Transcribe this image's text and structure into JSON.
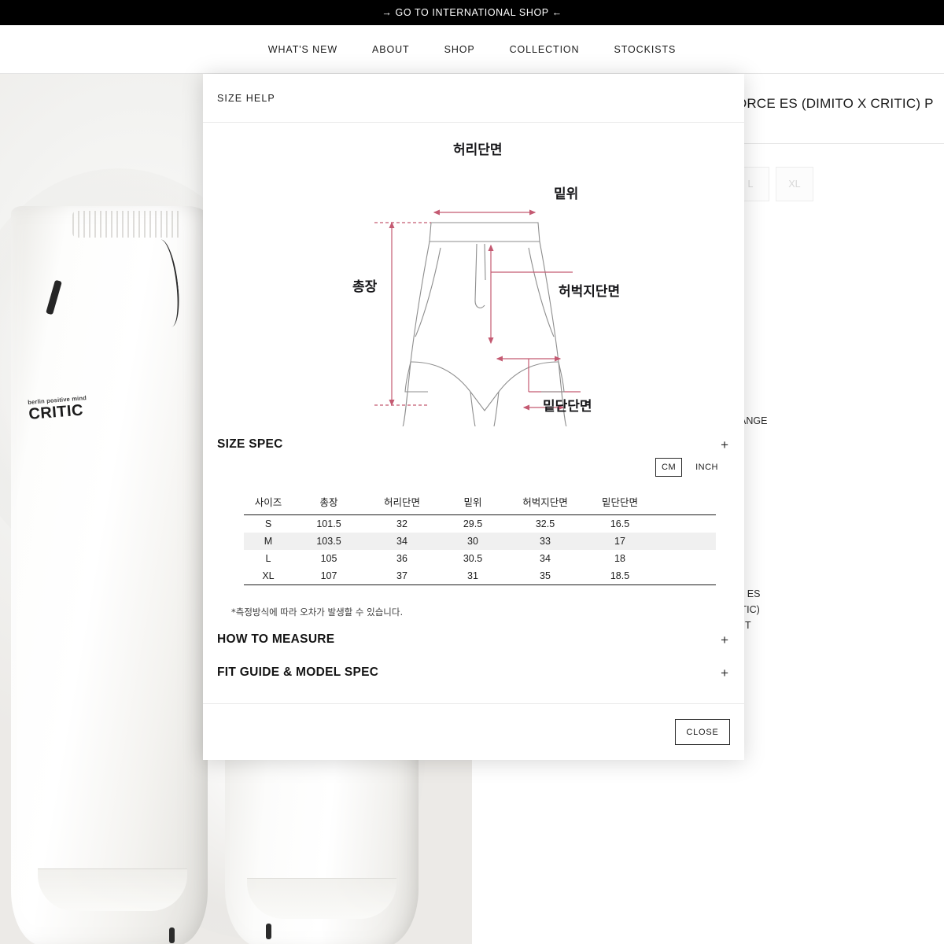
{
  "banner": {
    "text": "→ GO TO INTERNATIONAL SHOP ←"
  },
  "nav": {
    "items": [
      {
        "label": "WHAT'S NEW"
      },
      {
        "label": "ABOUT"
      },
      {
        "label": "SHOP"
      },
      {
        "label": "COLLECTION"
      },
      {
        "label": "STOCKISTS"
      }
    ]
  },
  "product": {
    "title_fragment": "ORCE ES (DIMITO X CRITIC) P",
    "sizes": [
      {
        "label": "L",
        "disabled": true
      },
      {
        "label": "XL",
        "disabled": true
      }
    ],
    "info_fragment_1": "ANGE",
    "info_fragment_2": "E ES",
    "info_fragment_3": "ITIC)",
    "info_fragment_4": "HT",
    "brand_small": "berlin positive mind",
    "brand_main": "CRITIC"
  },
  "modal": {
    "title": "SIZE HELP",
    "close_label": "CLOSE",
    "diagram": {
      "line_color": "#c45a72",
      "outline_color": "#8e8e8e",
      "labels": [
        {
          "key": "waist",
          "text": "허리단면"
        },
        {
          "key": "rise",
          "text": "밑위"
        },
        {
          "key": "length",
          "text": "총장"
        },
        {
          "key": "thigh",
          "text": "허벅지단면"
        },
        {
          "key": "hem",
          "text": "밑단단면"
        }
      ]
    },
    "size_spec": {
      "title": "SIZE SPEC",
      "toggle_icon": "+",
      "units": [
        {
          "label": "CM",
          "selected": true
        },
        {
          "label": "INCH",
          "selected": false
        }
      ],
      "columns": [
        "사이즈",
        "총장",
        "허리단면",
        "밑위",
        "허벅지단면",
        "밑단단면",
        ""
      ],
      "rows": [
        {
          "cells": [
            "S",
            "101.5",
            "32",
            "29.5",
            "32.5",
            "16.5",
            ""
          ],
          "highlight": false
        },
        {
          "cells": [
            "M",
            "103.5",
            "34",
            "30",
            "33",
            "17",
            ""
          ],
          "highlight": true
        },
        {
          "cells": [
            "L",
            "105",
            "36",
            "30.5",
            "34",
            "18",
            ""
          ],
          "highlight": false
        },
        {
          "cells": [
            "XL",
            "107",
            "37",
            "31",
            "35",
            "18.5",
            ""
          ],
          "highlight": false
        }
      ],
      "note": "*측정방식에 따라 오차가 발생할 수 있습니다."
    },
    "sections": [
      {
        "title": "HOW TO MEASURE",
        "toggle_icon": "+"
      },
      {
        "title": "FIT GUIDE & MODEL SPEC",
        "toggle_icon": "+"
      }
    ]
  },
  "colors": {
    "banner_bg": "#000000",
    "accent_line": "#c45a72",
    "highlight_row": "#f0f0f0",
    "text": "#1c1c1c"
  }
}
